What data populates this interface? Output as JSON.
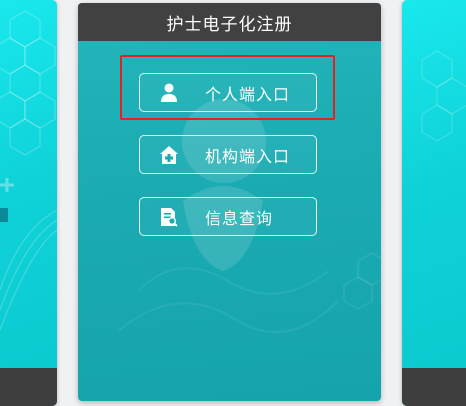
{
  "main_card": {
    "title": "护士电子化注册",
    "buttons": [
      {
        "label": "个人端入口",
        "icon": "person-icon"
      },
      {
        "label": "机构端入口",
        "icon": "hospital-icon"
      },
      {
        "label": "信息查询",
        "icon": "document-search-icon"
      }
    ]
  },
  "colors": {
    "card_teal": "#1aaab1",
    "side_cyan": "#12d9df",
    "header_dark": "#414141",
    "highlight_red": "#e4211f"
  }
}
